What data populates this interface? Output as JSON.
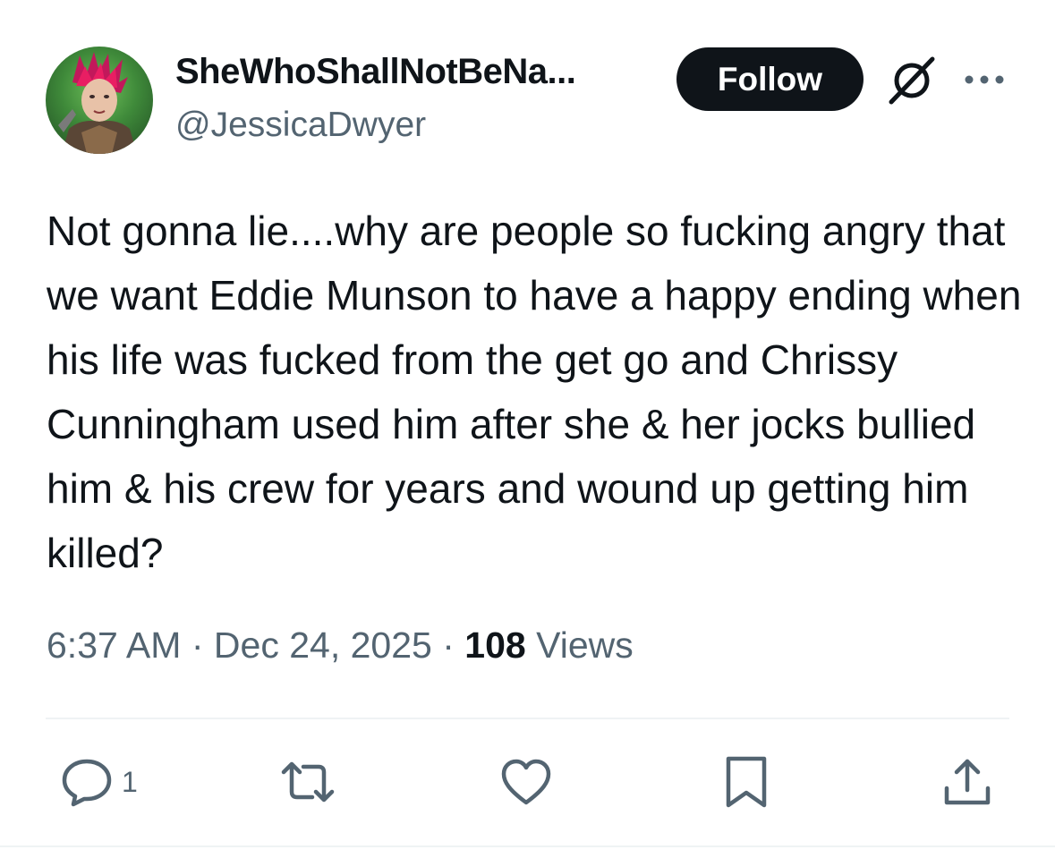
{
  "author": {
    "display_name": "SheWhoShallNotBeNa...",
    "handle": "@JessicaDwyer"
  },
  "header": {
    "follow_label": "Follow"
  },
  "tweet": {
    "text": "Not gonna lie....why are people so fucking angry that we want Eddie Munson to have a happy ending when his life was fucked from the get go and Chrissy Cunningham used him after she & her jocks bullied him & his crew for years and wound up getting him killed?",
    "time": "6:37 AM",
    "date": "Dec 24, 2025",
    "separator": "·",
    "views_count": "108",
    "views_label": "Views"
  },
  "actions": {
    "reply_count": "1",
    "icons": [
      "reply-icon",
      "retweet-icon",
      "like-icon",
      "bookmark-icon",
      "share-icon"
    ]
  },
  "colors": {
    "text_primary": "#0f1419",
    "text_secondary": "#536471",
    "divider": "#eff3f4",
    "follow_bg": "#0f1419"
  }
}
